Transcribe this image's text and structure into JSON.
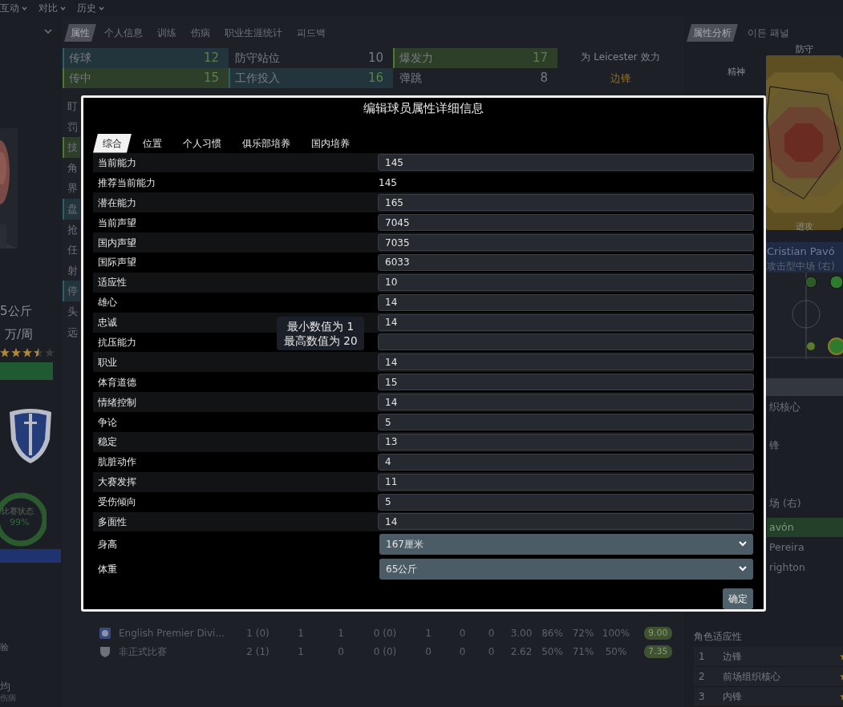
{
  "top_menu": [
    {
      "label": "互动"
    },
    {
      "label": "对比"
    },
    {
      "label": "历史"
    }
  ],
  "player_panel": {
    "weight": "5公斤",
    "wage": "万/周",
    "stars": 3.5,
    "form_label": "比赛状态",
    "form_value": "99%",
    "footer_texts": [
      "验",
      "均",
      "伤病"
    ]
  },
  "profile_tabs": [
    {
      "label": "属性",
      "selected": true
    },
    {
      "label": "个人信息",
      "selected": false
    },
    {
      "label": "训练",
      "selected": false
    },
    {
      "label": "伤病",
      "selected": false
    },
    {
      "label": "职业生涯统计",
      "selected": false
    },
    {
      "label": "피드백",
      "selected": false
    }
  ],
  "attributes": [
    {
      "name": "传球",
      "value": "12",
      "color": "#2f5f66"
    },
    {
      "name": "防守站位",
      "value": "10"
    },
    {
      "name": "爆发力",
      "value": "17",
      "color": "#4d7a2e"
    },
    {
      "name": "传中",
      "value": "15",
      "color": "#4d7a2e"
    },
    {
      "name": "工作投入",
      "value": "16",
      "color": "#2f5f66"
    },
    {
      "name": "弹跳",
      "value": "8"
    }
  ],
  "attribute_stubs": [
    {
      "name": "盯"
    },
    {
      "name": "罚"
    },
    {
      "name": "技",
      "color": "#4d7a2e"
    },
    {
      "name": "角"
    },
    {
      "name": "界"
    },
    {
      "name": "盘",
      "color": "#2f5f66"
    },
    {
      "name": "抢"
    },
    {
      "name": "任"
    },
    {
      "name": "射"
    },
    {
      "name": "停",
      "color": "#2f5f66"
    },
    {
      "name": "头"
    },
    {
      "name": "远"
    }
  ],
  "club_info": {
    "playing_for": "为 Leicester 效力",
    "position": "边锋"
  },
  "stats_rows": [
    {
      "kind": "league",
      "cells": [
        "English Premier Divi...",
        "1 (0)",
        "1",
        "1",
        "0 (0)",
        "1",
        "0",
        "0",
        "3.00",
        "86%",
        "72%",
        "100%"
      ],
      "rating": "9.00"
    },
    {
      "kind": "friendly",
      "cells": [
        "非正式比赛",
        "2 (1)",
        "1",
        "0",
        "0 (0)",
        "0",
        "0",
        "0",
        "2.62",
        "50%",
        "71%",
        "50%"
      ],
      "rating": "7.35"
    }
  ],
  "analysis_tabs": [
    {
      "label": "属性分析",
      "selected": true
    },
    {
      "label": "이든 패널",
      "selected": false
    }
  ],
  "radar": {
    "labels": [
      "防守",
      "精神",
      "进攻"
    ]
  },
  "player_name": "Cristian Pavó",
  "player_role": "攻击型中场 (右)",
  "side_snippets": [
    {
      "text": "织核心",
      "selected": false
    },
    {
      "text": "锋",
      "selected": false
    },
    {
      "text": "场 (右)",
      "selected": false
    },
    {
      "text": "avón",
      "selected": true
    },
    {
      "text": "Pereira",
      "selected": false
    },
    {
      "text": "righton",
      "selected": false
    }
  ],
  "role_suitability": {
    "title": "角色适应性",
    "rows": [
      {
        "rank": "1",
        "role": "边锋"
      },
      {
        "rank": "2",
        "role": "前场组织核心"
      },
      {
        "rank": "3",
        "role": "内锋"
      }
    ]
  },
  "dialog": {
    "title": "编辑球员属性详细信息",
    "tabs": [
      {
        "label": "综合",
        "selected": true
      },
      {
        "label": "位置",
        "selected": false
      },
      {
        "label": "个人习惯",
        "selected": false
      },
      {
        "label": "俱乐部培养",
        "selected": false
      },
      {
        "label": "国内培养",
        "selected": false
      }
    ],
    "fields": [
      {
        "kind": "input",
        "label": "当前能力",
        "value": "145"
      },
      {
        "kind": "text",
        "label": "推荐当前能力",
        "value": "145"
      },
      {
        "kind": "input",
        "label": "潜在能力",
        "value": "165"
      },
      {
        "kind": "input",
        "label": "当前声望",
        "value": "7045"
      },
      {
        "kind": "input",
        "label": "国内声望",
        "value": "7035"
      },
      {
        "kind": "input",
        "label": "国际声望",
        "value": "6033"
      },
      {
        "kind": "input",
        "label": "适应性",
        "value": "10"
      },
      {
        "kind": "input",
        "label": "雄心",
        "value": "14"
      },
      {
        "kind": "input",
        "label": "忠诚",
        "value": "14"
      },
      {
        "kind": "input",
        "label": "抗压能力"
      },
      {
        "kind": "input",
        "label": "职业",
        "value": "14"
      },
      {
        "kind": "input",
        "label": "体育道德",
        "value": "15"
      },
      {
        "kind": "input",
        "label": "情绪控制",
        "value": "14"
      },
      {
        "kind": "input",
        "label": "争论",
        "value": "5"
      },
      {
        "kind": "input",
        "label": "稳定",
        "value": "13"
      },
      {
        "kind": "input",
        "label": "肮脏动作",
        "value": "4"
      },
      {
        "kind": "input",
        "label": "大赛发挥",
        "value": "11"
      },
      {
        "kind": "input",
        "label": "受伤倾向",
        "value": "5"
      },
      {
        "kind": "input",
        "label": "多面性",
        "value": "14"
      },
      {
        "kind": "select",
        "label": "身高",
        "value": "167厘米"
      },
      {
        "kind": "select",
        "label": "体重",
        "value": "65公斤"
      }
    ],
    "tooltip": [
      "最小数值为 1",
      "最高数值为 20"
    ],
    "ok_button": "确定"
  }
}
